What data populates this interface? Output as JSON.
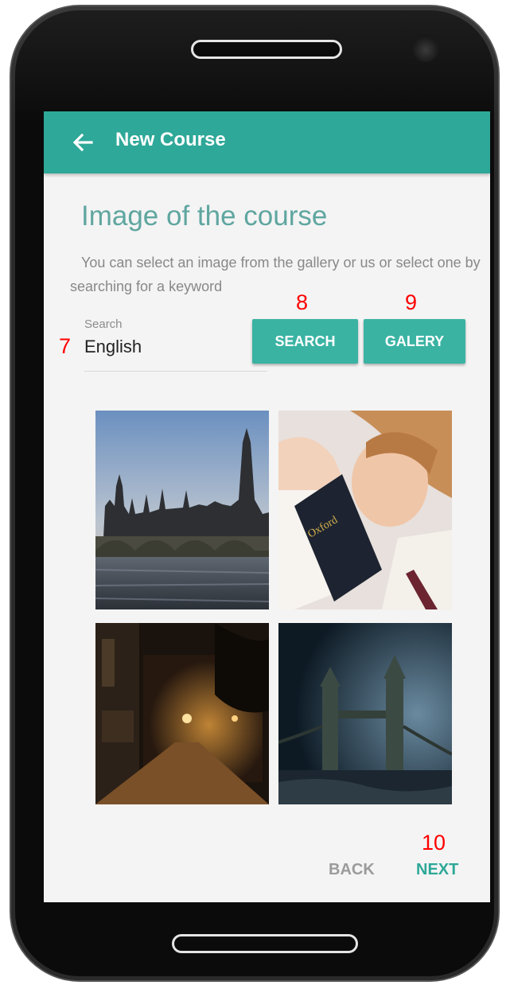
{
  "appbar": {
    "title": "New Course"
  },
  "page": {
    "heading": "Image of the course",
    "description": "You can select an image from the gallery or us or select one by searching for a keyword"
  },
  "search": {
    "label": "Search",
    "value": "English"
  },
  "buttons": {
    "search": "SEARCH",
    "gallery": "GALERY"
  },
  "images": [
    {
      "name": "london-parliament-image"
    },
    {
      "name": "girl-reading-dictionary-image"
    },
    {
      "name": "night-street-image"
    },
    {
      "name": "tower-bridge-image"
    }
  ],
  "footer": {
    "back": "BACK",
    "next": "NEXT"
  },
  "annotations": {
    "a7": "7",
    "a8": "8",
    "a9": "9",
    "a10": "10"
  },
  "colors": {
    "accent": "#2ea898",
    "button": "#3ab3a3",
    "heading": "#5fa6a0",
    "annotation": "#ff0000"
  }
}
